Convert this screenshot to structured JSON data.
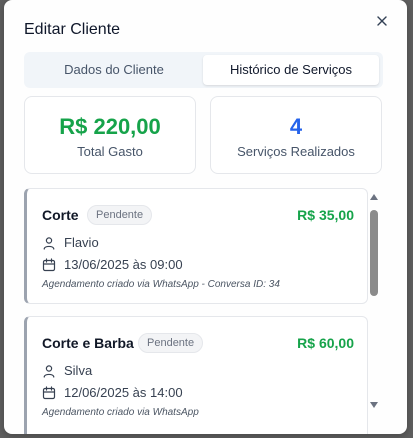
{
  "dialog": {
    "title": "Editar Cliente",
    "close_icon": "close-icon"
  },
  "tabs": [
    {
      "label": "Dados do Cliente",
      "active": false
    },
    {
      "label": "Histórico de Serviços",
      "active": true
    }
  ],
  "stats": {
    "total_spent": {
      "value": "R$ 220,00",
      "label": "Total Gasto"
    },
    "services_done": {
      "value": "4",
      "label": "Serviços Realizados"
    }
  },
  "services": [
    {
      "name": "Corte",
      "status": "Pendente",
      "price": "R$ 35,00",
      "person": "Flavio",
      "datetime": "13/06/2025 às 09:00",
      "note": "Agendamento criado via WhatsApp - Conversa ID: 34"
    },
    {
      "name": "Corte e Barba",
      "status": "Pendente",
      "price": "R$ 60,00",
      "person": "Silva",
      "datetime": "12/06/2025 às 14:00",
      "note": "Agendamento criado via WhatsApp"
    }
  ],
  "colors": {
    "accent_green": "#16a34a",
    "accent_blue": "#2563eb",
    "overlay": "#5f5f5f"
  }
}
